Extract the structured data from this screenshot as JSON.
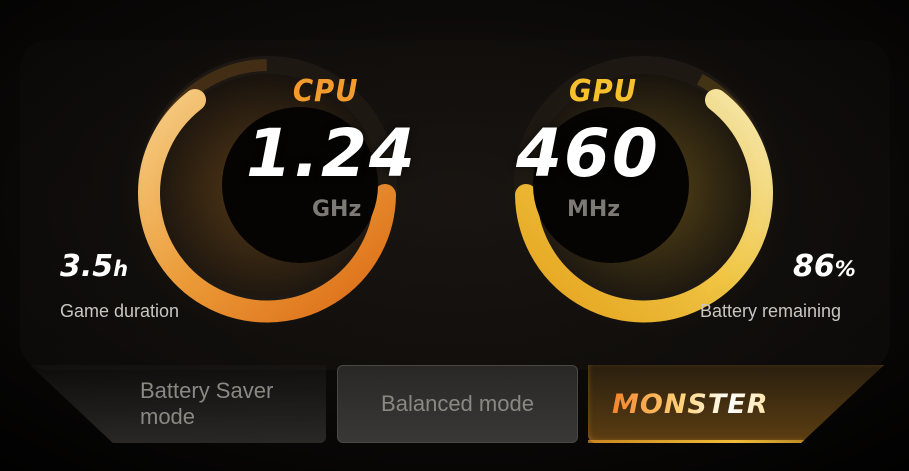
{
  "cpu": {
    "label": "CPU",
    "value": "1.24",
    "unit": "GHz",
    "color": "#f39b2c"
  },
  "gpu": {
    "label": "GPU",
    "value": "460",
    "unit": "MHz",
    "color": "#f7c02d"
  },
  "game_duration": {
    "value": "3.5",
    "suffix": "h",
    "label": "Game duration"
  },
  "battery": {
    "value": "86",
    "suffix": "%",
    "label": "Battery remaining"
  },
  "modes": {
    "saver_label": "Battery Saver mode",
    "balanced_label": "Balanced mode",
    "monster_label": "MONSTER",
    "selected": "MONSTER"
  },
  "colors": {
    "accent_orange": "#f39b2c",
    "accent_yellow": "#f7c02d",
    "background": "#000000"
  }
}
